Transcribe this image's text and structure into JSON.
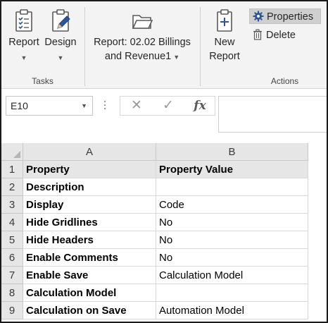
{
  "ribbon": {
    "tasks": {
      "label": "Tasks",
      "report_label": "Report",
      "design_label": "Design"
    },
    "report_picker": {
      "line1": "Report: 02.02 Billings",
      "line2": "and Revenue1"
    },
    "actions": {
      "label": "Actions",
      "new_line1": "New",
      "new_line2": "Report",
      "properties_label": "Properties",
      "delete_label": "Delete"
    }
  },
  "formula_bar": {
    "name_box": "E10",
    "cancel_glyph": "✕",
    "enter_glyph": "✓",
    "fx_label": "fx",
    "content": ""
  },
  "sheet": {
    "columns": [
      "A",
      "B"
    ],
    "rows": [
      {
        "num": "1",
        "a": "Property",
        "b": "Property Value"
      },
      {
        "num": "2",
        "a": "Description",
        "b": ""
      },
      {
        "num": "3",
        "a": "Display",
        "b": "Code"
      },
      {
        "num": "4",
        "a": "Hide Gridlines",
        "b": "No"
      },
      {
        "num": "5",
        "a": "Hide Headers",
        "b": "No"
      },
      {
        "num": "6",
        "a": "Enable Comments",
        "b": "No"
      },
      {
        "num": "7",
        "a": "Enable Save",
        "b": "Calculation Model"
      },
      {
        "num": "8",
        "a": "Calculation Model",
        "b": ""
      },
      {
        "num": "9",
        "a": "Calculation on Save",
        "b": "Automation Model"
      }
    ]
  },
  "colors": {
    "accent_blue": "#2b579a",
    "ribbon_bg": "#f3f3f3",
    "header_bg": "#e6e6e6",
    "header_row_fill": "#e7e6e6",
    "selected_button_bg": "#cfcfcf"
  }
}
